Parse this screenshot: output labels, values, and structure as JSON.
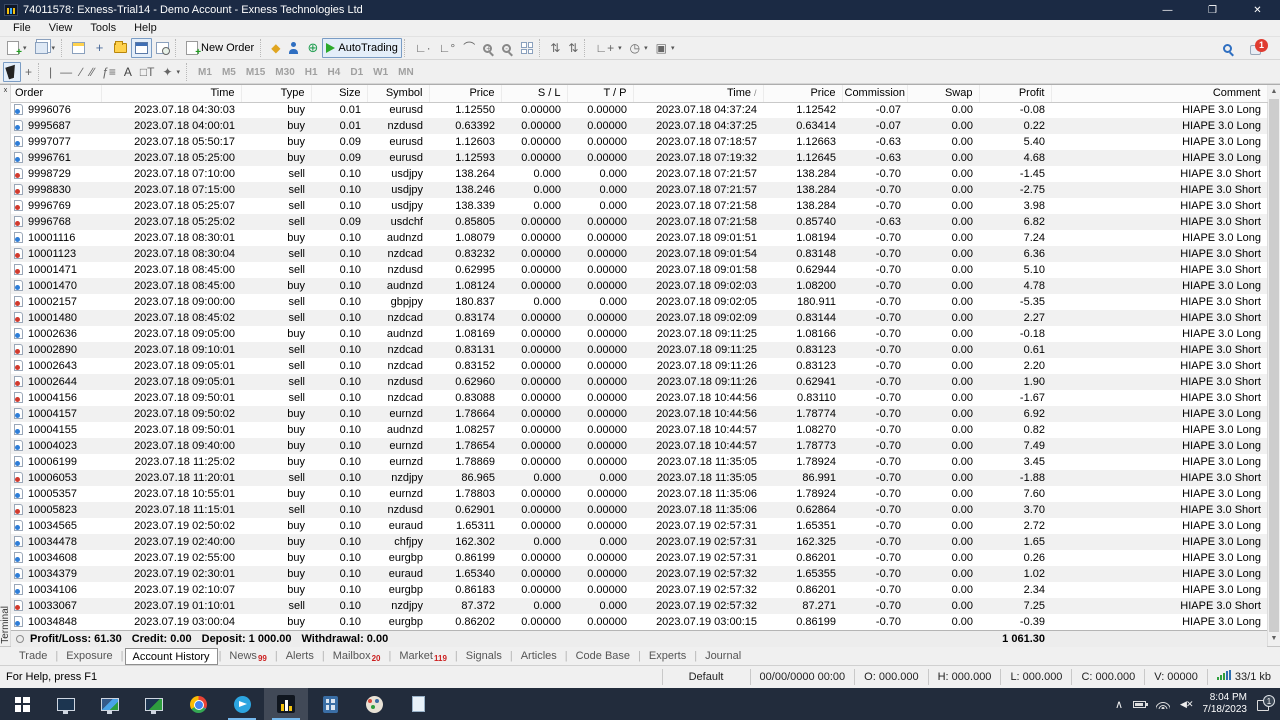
{
  "colors": {
    "titlebar": "#1b2a44",
    "taskbar": "#222c3c",
    "buy": "#2f7ed8",
    "sell": "#d23b2e",
    "badge": "#cc1f1f",
    "autotrading_green": "#2daa2d"
  },
  "window": {
    "title": "74011578: Exness-Trial14 - Demo Account - Exness Technologies Ltd"
  },
  "menu": {
    "items": [
      "File",
      "View",
      "Tools",
      "Help"
    ]
  },
  "toolbar": {
    "new_order_label": "New Order",
    "autotrading_label": "AutoTrading",
    "timeframes": [
      "M1",
      "M5",
      "M15",
      "M30",
      "H1",
      "H4",
      "D1",
      "W1",
      "MN"
    ],
    "notification_count": "1",
    "icons": [
      "new-chart-icon",
      "profiles-icon",
      "market-watch-icon",
      "data-window-icon",
      "navigator-icon",
      "terminal-icon",
      "strategy-tester-icon",
      "new-order-icon",
      "metaeditor-icon",
      "community-icon",
      "mql5-icon",
      "autotrading-play-icon",
      "indicators-icon",
      "objects-icon",
      "zoom-in-icon",
      "zoom-out-icon",
      "tile-windows-icon",
      "sort-ascending-icon",
      "sort-descending-icon",
      "add-indicator-icon",
      "periods-icon",
      "templates-icon",
      "search-icon",
      "notifications-icon",
      "cursor-icon",
      "crosshair-icon",
      "vertical-line-icon",
      "horizontal-line-icon",
      "trendline-icon",
      "channel-icon",
      "fibonacci-icon",
      "text-icon",
      "label-icon",
      "arrows-icon"
    ]
  },
  "table": {
    "columns": [
      "Order",
      "Time",
      "Type",
      "Size",
      "Symbol",
      "Price",
      "S / L",
      "T / P",
      "Time",
      "Price",
      "Commission",
      "Swap",
      "Profit",
      "Comment"
    ],
    "sort_column_index": 8,
    "sort_marker": "/",
    "rows": [
      [
        "9996076",
        "2023.07.18 04:30:03",
        "buy",
        "0.01",
        "eurusd",
        "1.12550",
        "0.00000",
        "0.00000",
        "2023.07.18 04:37:24",
        "1.12542",
        "-0.07",
        "0.00",
        "-0.08",
        "HIAPE 3.0 Long"
      ],
      [
        "9995687",
        "2023.07.18 04:00:01",
        "buy",
        "0.01",
        "nzdusd",
        "0.63392",
        "0.00000",
        "0.00000",
        "2023.07.18 04:37:25",
        "0.63414",
        "-0.07",
        "0.00",
        "0.22",
        "HIAPE 3.0 Long"
      ],
      [
        "9997077",
        "2023.07.18 05:50:17",
        "buy",
        "0.09",
        "eurusd",
        "1.12603",
        "0.00000",
        "0.00000",
        "2023.07.18 07:18:57",
        "1.12663",
        "-0.63",
        "0.00",
        "5.40",
        "HIAPE 3.0 Long"
      ],
      [
        "9996761",
        "2023.07.18 05:25:00",
        "buy",
        "0.09",
        "eurusd",
        "1.12593",
        "0.00000",
        "0.00000",
        "2023.07.18 07:19:32",
        "1.12645",
        "-0.63",
        "0.00",
        "4.68",
        "HIAPE 3.0 Long"
      ],
      [
        "9998729",
        "2023.07.18 07:10:00",
        "sell",
        "0.10",
        "usdjpy",
        "138.264",
        "0.000",
        "0.000",
        "2023.07.18 07:21:57",
        "138.284",
        "-0.70",
        "0.00",
        "-1.45",
        "HIAPE 3.0 Short"
      ],
      [
        "9998830",
        "2023.07.18 07:15:00",
        "sell",
        "0.10",
        "usdjpy",
        "138.246",
        "0.000",
        "0.000",
        "2023.07.18 07:21:57",
        "138.284",
        "-0.70",
        "0.00",
        "-2.75",
        "HIAPE 3.0 Short"
      ],
      [
        "9996769",
        "2023.07.18 05:25:07",
        "sell",
        "0.10",
        "usdjpy",
        "138.339",
        "0.000",
        "0.000",
        "2023.07.18 07:21:58",
        "138.284",
        "-0.70",
        "0.00",
        "3.98",
        "HIAPE 3.0 Short"
      ],
      [
        "9996768",
        "2023.07.18 05:25:02",
        "sell",
        "0.09",
        "usdchf",
        "0.85805",
        "0.00000",
        "0.00000",
        "2023.07.18 07:21:58",
        "0.85740",
        "-0.63",
        "0.00",
        "6.82",
        "HIAPE 3.0 Short"
      ],
      [
        "10001116",
        "2023.07.18 08:30:01",
        "buy",
        "0.10",
        "audnzd",
        "1.08079",
        "0.00000",
        "0.00000",
        "2023.07.18 09:01:51",
        "1.08194",
        "-0.70",
        "0.00",
        "7.24",
        "HIAPE 3.0 Long"
      ],
      [
        "10001123",
        "2023.07.18 08:30:04",
        "sell",
        "0.10",
        "nzdcad",
        "0.83232",
        "0.00000",
        "0.00000",
        "2023.07.18 09:01:54",
        "0.83148",
        "-0.70",
        "0.00",
        "6.36",
        "HIAPE 3.0 Short"
      ],
      [
        "10001471",
        "2023.07.18 08:45:00",
        "sell",
        "0.10",
        "nzdusd",
        "0.62995",
        "0.00000",
        "0.00000",
        "2023.07.18 09:01:58",
        "0.62944",
        "-0.70",
        "0.00",
        "5.10",
        "HIAPE 3.0 Short"
      ],
      [
        "10001470",
        "2023.07.18 08:45:00",
        "buy",
        "0.10",
        "audnzd",
        "1.08124",
        "0.00000",
        "0.00000",
        "2023.07.18 09:02:03",
        "1.08200",
        "-0.70",
        "0.00",
        "4.78",
        "HIAPE 3.0 Long"
      ],
      [
        "10002157",
        "2023.07.18 09:00:00",
        "sell",
        "0.10",
        "gbpjpy",
        "180.837",
        "0.000",
        "0.000",
        "2023.07.18 09:02:05",
        "180.911",
        "-0.70",
        "0.00",
        "-5.35",
        "HIAPE 3.0 Short"
      ],
      [
        "10001480",
        "2023.07.18 08:45:02",
        "sell",
        "0.10",
        "nzdcad",
        "0.83174",
        "0.00000",
        "0.00000",
        "2023.07.18 09:02:09",
        "0.83144",
        "-0.70",
        "0.00",
        "2.27",
        "HIAPE 3.0 Short"
      ],
      [
        "10002636",
        "2023.07.18 09:05:00",
        "buy",
        "0.10",
        "audnzd",
        "1.08169",
        "0.00000",
        "0.00000",
        "2023.07.18 09:11:25",
        "1.08166",
        "-0.70",
        "0.00",
        "-0.18",
        "HIAPE 3.0 Long"
      ],
      [
        "10002890",
        "2023.07.18 09:10:01",
        "sell",
        "0.10",
        "nzdcad",
        "0.83131",
        "0.00000",
        "0.00000",
        "2023.07.18 09:11:25",
        "0.83123",
        "-0.70",
        "0.00",
        "0.61",
        "HIAPE 3.0 Short"
      ],
      [
        "10002643",
        "2023.07.18 09:05:01",
        "sell",
        "0.10",
        "nzdcad",
        "0.83152",
        "0.00000",
        "0.00000",
        "2023.07.18 09:11:26",
        "0.83123",
        "-0.70",
        "0.00",
        "2.20",
        "HIAPE 3.0 Short"
      ],
      [
        "10002644",
        "2023.07.18 09:05:01",
        "sell",
        "0.10",
        "nzdusd",
        "0.62960",
        "0.00000",
        "0.00000",
        "2023.07.18 09:11:26",
        "0.62941",
        "-0.70",
        "0.00",
        "1.90",
        "HIAPE 3.0 Short"
      ],
      [
        "10004156",
        "2023.07.18 09:50:01",
        "sell",
        "0.10",
        "nzdcad",
        "0.83088",
        "0.00000",
        "0.00000",
        "2023.07.18 10:44:56",
        "0.83110",
        "-0.70",
        "0.00",
        "-1.67",
        "HIAPE 3.0 Short"
      ],
      [
        "10004157",
        "2023.07.18 09:50:02",
        "buy",
        "0.10",
        "eurnzd",
        "1.78664",
        "0.00000",
        "0.00000",
        "2023.07.18 10:44:56",
        "1.78774",
        "-0.70",
        "0.00",
        "6.92",
        "HIAPE 3.0 Long"
      ],
      [
        "10004155",
        "2023.07.18 09:50:01",
        "buy",
        "0.10",
        "audnzd",
        "1.08257",
        "0.00000",
        "0.00000",
        "2023.07.18 10:44:57",
        "1.08270",
        "-0.70",
        "0.00",
        "0.82",
        "HIAPE 3.0 Long"
      ],
      [
        "10004023",
        "2023.07.18 09:40:00",
        "buy",
        "0.10",
        "eurnzd",
        "1.78654",
        "0.00000",
        "0.00000",
        "2023.07.18 10:44:57",
        "1.78773",
        "-0.70",
        "0.00",
        "7.49",
        "HIAPE 3.0 Long"
      ],
      [
        "10006199",
        "2023.07.18 11:25:02",
        "buy",
        "0.10",
        "eurnzd",
        "1.78869",
        "0.00000",
        "0.00000",
        "2023.07.18 11:35:05",
        "1.78924",
        "-0.70",
        "0.00",
        "3.45",
        "HIAPE 3.0 Long"
      ],
      [
        "10006053",
        "2023.07.18 11:20:01",
        "sell",
        "0.10",
        "nzdjpy",
        "86.965",
        "0.000",
        "0.000",
        "2023.07.18 11:35:05",
        "86.991",
        "-0.70",
        "0.00",
        "-1.88",
        "HIAPE 3.0 Short"
      ],
      [
        "10005357",
        "2023.07.18 10:55:01",
        "buy",
        "0.10",
        "eurnzd",
        "1.78803",
        "0.00000",
        "0.00000",
        "2023.07.18 11:35:06",
        "1.78924",
        "-0.70",
        "0.00",
        "7.60",
        "HIAPE 3.0 Long"
      ],
      [
        "10005823",
        "2023.07.18 11:15:01",
        "sell",
        "0.10",
        "nzdusd",
        "0.62901",
        "0.00000",
        "0.00000",
        "2023.07.18 11:35:06",
        "0.62864",
        "-0.70",
        "0.00",
        "3.70",
        "HIAPE 3.0 Short"
      ],
      [
        "10034565",
        "2023.07.19 02:50:02",
        "buy",
        "0.10",
        "euraud",
        "1.65311",
        "0.00000",
        "0.00000",
        "2023.07.19 02:57:31",
        "1.65351",
        "-0.70",
        "0.00",
        "2.72",
        "HIAPE 3.0 Long"
      ],
      [
        "10034478",
        "2023.07.19 02:40:00",
        "buy",
        "0.10",
        "chfjpy",
        "162.302",
        "0.000",
        "0.000",
        "2023.07.19 02:57:31",
        "162.325",
        "-0.70",
        "0.00",
        "1.65",
        "HIAPE 3.0 Long"
      ],
      [
        "10034608",
        "2023.07.19 02:55:00",
        "buy",
        "0.10",
        "eurgbp",
        "0.86199",
        "0.00000",
        "0.00000",
        "2023.07.19 02:57:31",
        "0.86201",
        "-0.70",
        "0.00",
        "0.26",
        "HIAPE 3.0 Long"
      ],
      [
        "10034379",
        "2023.07.19 02:30:01",
        "buy",
        "0.10",
        "euraud",
        "1.65340",
        "0.00000",
        "0.00000",
        "2023.07.19 02:57:32",
        "1.65355",
        "-0.70",
        "0.00",
        "1.02",
        "HIAPE 3.0 Long"
      ],
      [
        "10034106",
        "2023.07.19 02:10:07",
        "buy",
        "0.10",
        "eurgbp",
        "0.86183",
        "0.00000",
        "0.00000",
        "2023.07.19 02:57:32",
        "0.86201",
        "-0.70",
        "0.00",
        "2.34",
        "HIAPE 3.0 Long"
      ],
      [
        "10033067",
        "2023.07.19 01:10:01",
        "sell",
        "0.10",
        "nzdjpy",
        "87.372",
        "0.000",
        "0.000",
        "2023.07.19 02:57:32",
        "87.271",
        "-0.70",
        "0.00",
        "7.25",
        "HIAPE 3.0 Short"
      ],
      [
        "10034848",
        "2023.07.19 03:00:04",
        "buy",
        "0.10",
        "eurgbp",
        "0.86202",
        "0.00000",
        "0.00000",
        "2023.07.19 03:00:15",
        "0.86199",
        "-0.70",
        "0.00",
        "-0.39",
        "HIAPE 3.0 Long"
      ]
    ]
  },
  "summary": {
    "segments": [
      "Profit/Loss: 61.30",
      "Credit: 0.00",
      "Deposit: 1 000.00",
      "Withdrawal: 0.00"
    ],
    "total": "1 061.30"
  },
  "terminal_panel": {
    "label": "Terminal",
    "close": "x"
  },
  "tabs": [
    {
      "label": "Trade"
    },
    {
      "label": "Exposure"
    },
    {
      "label": "Account History",
      "active": true
    },
    {
      "label": "News",
      "badge": "99"
    },
    {
      "label": "Alerts"
    },
    {
      "label": "Mailbox",
      "badge": "20"
    },
    {
      "label": "Market",
      "badge": "119"
    },
    {
      "label": "Signals"
    },
    {
      "label": "Articles"
    },
    {
      "label": "Code Base"
    },
    {
      "label": "Experts"
    },
    {
      "label": "Journal"
    }
  ],
  "statusbar": {
    "help": "For Help, press F1",
    "profile": "Default",
    "segments": [
      "00/00/0000 00:00",
      "O: 000.000",
      "H: 000.000",
      "L: 000.000",
      "C: 000.000",
      "V: 00000"
    ],
    "connection": "33/1 kb"
  },
  "taskbar": {
    "apps": [
      {
        "id": "start"
      },
      {
        "id": "pc-app"
      },
      {
        "id": "monitor-app"
      },
      {
        "id": "remote-app"
      },
      {
        "id": "chrome"
      },
      {
        "id": "telegram",
        "running": true
      },
      {
        "id": "metatrader4",
        "running": true,
        "focused": true
      },
      {
        "id": "calculator"
      },
      {
        "id": "paint"
      },
      {
        "id": "notepad"
      }
    ],
    "tray": {
      "clock_time": "8:04 PM",
      "clock_date": "7/18/2023",
      "notification_count": "1"
    }
  }
}
